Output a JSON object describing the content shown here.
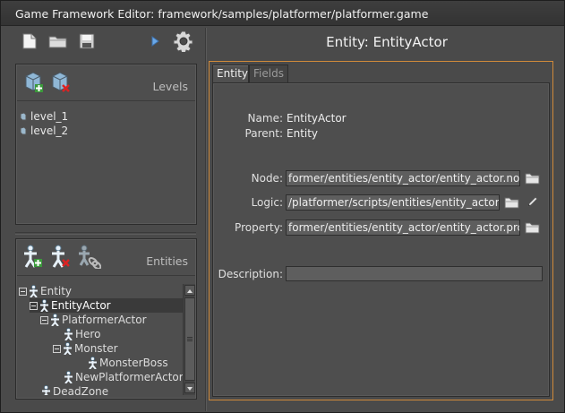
{
  "window": {
    "title": "Game Framework Editor: framework/samples/platformer/platformer.game"
  },
  "toolbar": {
    "icons": [
      "new-file-icon",
      "open-folder-icon",
      "save-disk-icon",
      "play-arrow-icon",
      "settings-gear-icon"
    ]
  },
  "levels": {
    "title": "Levels",
    "icons": [
      "add-level-icon",
      "remove-level-icon"
    ],
    "items": [
      "level_1",
      "level_2"
    ]
  },
  "entities": {
    "title": "Entities",
    "icons": [
      "add-entity-icon",
      "remove-entity-icon",
      "link-entity-icon"
    ],
    "tree": [
      {
        "label": "Entity",
        "depth": 0,
        "expanded": true,
        "selected": false
      },
      {
        "label": "EntityActor",
        "depth": 1,
        "expanded": true,
        "selected": true
      },
      {
        "label": "PlatformerActor",
        "depth": 2,
        "expanded": true,
        "selected": false
      },
      {
        "label": "Hero",
        "depth": 3,
        "expanded": false,
        "selected": false
      },
      {
        "label": "Monster",
        "depth": 3,
        "expanded": true,
        "selected": false
      },
      {
        "label": "MonsterBoss",
        "depth": 4,
        "expanded": false,
        "selected": false
      },
      {
        "label": "NewPlatformerActor",
        "depth": 3,
        "expanded": false,
        "selected": false
      },
      {
        "label": "DeadZone",
        "depth": 1,
        "expanded": false,
        "selected": false
      }
    ]
  },
  "details": {
    "title": "Entity: EntityActor",
    "tabs": [
      {
        "label": "Entity",
        "active": true
      },
      {
        "label": "Fields",
        "active": false
      }
    ],
    "name_label": "Name:",
    "name_value": "EntityActor",
    "parent_label": "Parent:",
    "parent_value": "Entity",
    "node_label": "Node:",
    "node_value": "former/entities/entity_actor/entity_actor.node",
    "logic_label": "Logic:",
    "logic_value": "/platformer/scripts/entities/entity_actor.h",
    "property_label": "Property:",
    "property_value": "former/entities/entity_actor/entity_actor.prop",
    "description_label": "Description:",
    "description_value": ""
  },
  "colors": {
    "accent_frame": "#d08a3a",
    "background": "#4a4a4a",
    "selection": "#3a3a3a"
  }
}
